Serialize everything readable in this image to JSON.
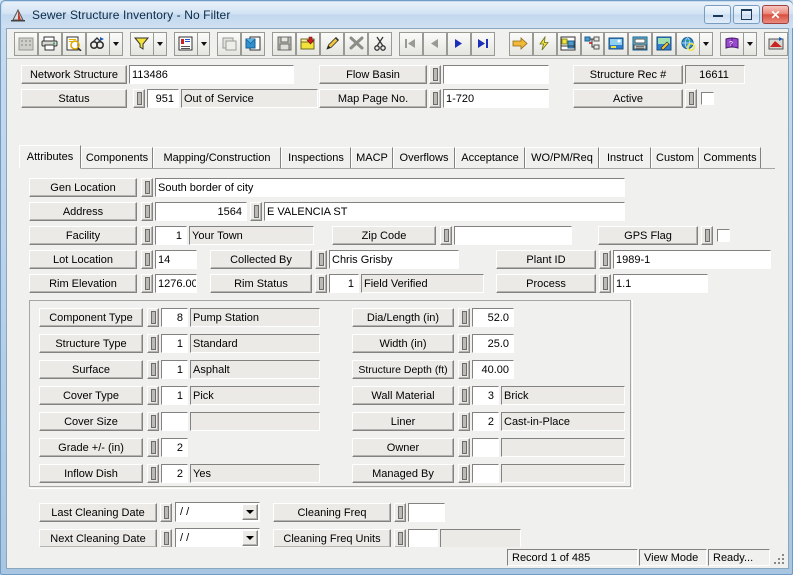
{
  "window": {
    "title": "Sewer Structure Inventory - No Filter",
    "icon": "manhole-icon",
    "minimize_label": "Minimize",
    "maximize_label": "Maximize",
    "close_label": "Close"
  },
  "toolbar": {
    "buttons": [
      {
        "name": "grid-view-icon",
        "tip": "Grid View",
        "enabled": false
      },
      {
        "name": "print-icon",
        "tip": "Print",
        "enabled": true
      },
      {
        "name": "print-preview-icon",
        "tip": "Print Preview",
        "enabled": true
      },
      {
        "name": "find-icon",
        "tip": "Find",
        "enabled": true,
        "dropdown": true
      },
      {
        "name": "filter-icon",
        "tip": "Filter",
        "enabled": true,
        "dropdown": true
      },
      {
        "name": "report-icon",
        "tip": "Reports",
        "enabled": true,
        "dropdown": true
      },
      {
        "name": "copy-record-icon",
        "tip": "Copy Record",
        "enabled": false
      },
      {
        "name": "duplicate-icon",
        "tip": "Duplicate",
        "enabled": true
      },
      {
        "name": "save-icon",
        "tip": "Save",
        "enabled": false
      },
      {
        "name": "add-record-icon",
        "tip": "Add Record",
        "enabled": true
      },
      {
        "name": "edit-icon",
        "tip": "Edit",
        "enabled": true
      },
      {
        "name": "delete-icon",
        "tip": "Delete",
        "enabled": true
      },
      {
        "name": "cut-icon",
        "tip": "Cut",
        "enabled": true
      },
      {
        "name": "first-record-icon",
        "tip": "First Record",
        "enabled": false
      },
      {
        "name": "previous-record-icon",
        "tip": "Previous Record",
        "enabled": false
      },
      {
        "name": "next-record-icon",
        "tip": "Next Record",
        "enabled": true
      },
      {
        "name": "last-record-icon",
        "tip": "Last Record",
        "enabled": true
      },
      {
        "name": "goto-icon",
        "tip": "Go To",
        "enabled": true
      },
      {
        "name": "lightning-icon",
        "tip": "Quick Action",
        "enabled": true
      },
      {
        "name": "map-icon",
        "tip": "Map",
        "enabled": true
      },
      {
        "name": "tree-view-icon",
        "tip": "Tree View",
        "enabled": true
      },
      {
        "name": "image-icon",
        "tip": "Images",
        "enabled": true
      },
      {
        "name": "fax-icon",
        "tip": "Fax",
        "enabled": true
      },
      {
        "name": "photo-edit-icon",
        "tip": "Photo Edit",
        "enabled": true
      },
      {
        "name": "globe-icon",
        "tip": "Web",
        "enabled": true,
        "dropdown": true
      },
      {
        "name": "help-book-icon",
        "tip": "Help",
        "enabled": true,
        "dropdown": true
      },
      {
        "name": "export-icon",
        "tip": "Export",
        "enabled": true
      }
    ]
  },
  "header": {
    "network_structure": {
      "label": "Network Structure",
      "value": "113486"
    },
    "status": {
      "label": "Status",
      "code": "951",
      "value": "Out of Service"
    },
    "flow_basin": {
      "label": "Flow Basin",
      "value": ""
    },
    "map_page_no": {
      "label": "Map Page No.",
      "value": "1-720"
    },
    "structure_rec": {
      "label": "Structure Rec #",
      "value": "16611"
    },
    "active": {
      "label": "Active",
      "checked": false
    }
  },
  "tabs": [
    {
      "label": "Attributes",
      "active": true
    },
    {
      "label": "Components",
      "active": false
    },
    {
      "label": "Mapping/Construction",
      "active": false
    },
    {
      "label": "Inspections",
      "active": false
    },
    {
      "label": "MACP",
      "active": false
    },
    {
      "label": "Overflows",
      "active": false
    },
    {
      "label": "Acceptance",
      "active": false
    },
    {
      "label": "WO/PM/Req",
      "active": false
    },
    {
      "label": "Instruct",
      "active": false
    },
    {
      "label": "Custom",
      "active": false
    },
    {
      "label": "Comments",
      "active": false
    }
  ],
  "attributes": {
    "gen_location": {
      "label": "Gen Location",
      "value": "South border of city"
    },
    "address": {
      "label": "Address",
      "number": "1564",
      "street": "E VALENCIA ST"
    },
    "facility": {
      "label": "Facility",
      "code": "1",
      "value": "Your Town"
    },
    "zip_code": {
      "label": "Zip Code",
      "value": ""
    },
    "gps_flag": {
      "label": "GPS Flag",
      "checked": false
    },
    "lot_location": {
      "label": "Lot Location",
      "value": "14"
    },
    "collected_by": {
      "label": "Collected By",
      "value": "Chris Grisby"
    },
    "plant_id": {
      "label": "Plant ID",
      "value": "1989-1"
    },
    "rim_elevation": {
      "label": "Rim Elevation",
      "value": "1276.00"
    },
    "rim_status": {
      "label": "Rim Status",
      "code": "1",
      "value": "Field Verified"
    },
    "process": {
      "label": "Process",
      "value": "1.1"
    }
  },
  "structure_group": {
    "left": [
      {
        "label": "Component Type",
        "code": "8",
        "value": "Pump Station",
        "has_desc": true
      },
      {
        "label": "Structure Type",
        "code": "1",
        "value": "Standard",
        "has_desc": true
      },
      {
        "label": "Surface",
        "code": "1",
        "value": "Asphalt",
        "has_desc": true
      },
      {
        "label": "Cover Type",
        "code": "1",
        "value": "Pick",
        "has_desc": true
      },
      {
        "label": "Cover Size",
        "code": "",
        "value": "",
        "has_desc": true
      },
      {
        "label": "Grade +/- (in)",
        "code": "2",
        "value": "",
        "has_desc": false
      },
      {
        "label": "Inflow Dish",
        "code": "2",
        "value": "Yes",
        "has_desc": true
      }
    ],
    "right": [
      {
        "label": "Dia/Length (in)",
        "code": "52.0",
        "value": "",
        "has_desc": false
      },
      {
        "label": "Width (in)",
        "code": "25.0",
        "value": "",
        "has_desc": false
      },
      {
        "label": "Structure Depth (ft)",
        "code": "40.00",
        "value": "",
        "has_desc": false
      },
      {
        "label": "Wall Material",
        "code": "3",
        "value": "Brick",
        "has_desc": true
      },
      {
        "label": "Liner",
        "code": "2",
        "value": "Cast-in-Place",
        "has_desc": true
      },
      {
        "label": "Owner",
        "code": "",
        "value": "",
        "has_desc": true
      },
      {
        "label": "Managed By",
        "code": "",
        "value": "",
        "has_desc": true
      }
    ]
  },
  "cleaning": {
    "last_cleaning_date": {
      "label": "Last Cleaning Date",
      "value": "  /  /"
    },
    "next_cleaning_date": {
      "label": "Next Cleaning Date",
      "value": "  /  /"
    },
    "cleaning_freq": {
      "label": "Cleaning Freq",
      "value": ""
    },
    "cleaning_freq_units": {
      "label": "Cleaning Freq Units",
      "code": "",
      "value": ""
    }
  },
  "statusbar": {
    "record": "Record 1 of 485",
    "mode": "View Mode",
    "state": "Ready..."
  }
}
